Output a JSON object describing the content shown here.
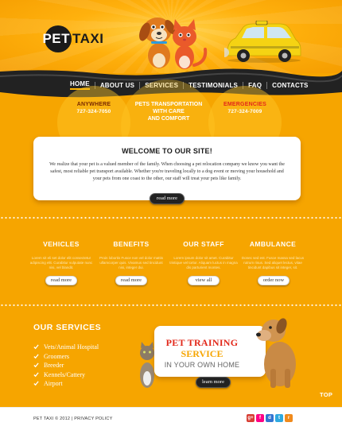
{
  "brand": {
    "logo_circle": "PET",
    "logo_rest": "TAXI"
  },
  "nav": {
    "items": [
      "HOME",
      "ABOUT US",
      "SERVICES",
      "TESTIMONIALS",
      "FAQ",
      "CONTACTS"
    ],
    "active": "HOME"
  },
  "contacts": {
    "anywhere": {
      "title": "ANYWHERE",
      "phone": "727-324-7050"
    },
    "tagline": [
      "PETS TRANSPORTATION",
      "WITH CARE",
      "AND COMFORT"
    ],
    "emergencies": {
      "title": "EMERGENCIES",
      "phone": "727-324-7009"
    }
  },
  "welcome": {
    "title": "WELCOME TO OUR SITE!",
    "text": "We realize that your pet is a valued member of the family. When choosing a pet relocation company we know you want the safest, most reliable pet transport available. Whether you're traveling locally to a dog event or moving your household and your pets from one coast to the other, our staff will treat your pets like family.",
    "button": "read more"
  },
  "features": [
    {
      "title": "VEHICLES",
      "text": "Lorem sit eli set dolor elit consectetur adipiscing elit. Curabitur vulputate nunc nisi, vel blandit.",
      "button": "read more"
    },
    {
      "title": "BENEFITS",
      "text": "Proin lobortis Fusce non vel dolor mattis ullamcorper quis. Vivamus sed tincidunt nisi, integer dui.",
      "button": "read more"
    },
    {
      "title": "OUR STAFF",
      "text": "Lorem ipsum dolor sit amet. Curabitur tristique vel tortor. Aliquam luctus in magna dis parturient montes.",
      "button": "view all"
    },
    {
      "title": "AMBULANCE",
      "text": "Donec sed est. Fusce massa sed lacus rutrum risus. Sed aliquet lectus, vitae tincidunt dapibus sit integer, sit.",
      "button": "order now"
    }
  ],
  "services": {
    "title": "OUR SERVICES",
    "items": [
      "Vets/Animal Hospital",
      "Groomers",
      "Breeder",
      "Kennels/Cattery",
      "Airport"
    ]
  },
  "promo": {
    "line1": "PET TRAINING",
    "line2": "SERVICE",
    "line3": "IN YOUR OWN HOME",
    "button": "learn more"
  },
  "top_link": "TOP",
  "footer": {
    "copyright": "PET TAXI © 2012",
    "separator": "|",
    "privacy": "PRIVACY POLICY"
  },
  "social": [
    {
      "name": "google-plus",
      "glyph": "g+",
      "color": "#d73d32"
    },
    {
      "name": "flickr",
      "glyph": "f",
      "color": "#ff0084"
    },
    {
      "name": "delicious",
      "glyph": "d",
      "color": "#3274d1"
    },
    {
      "name": "twitter",
      "glyph": "t",
      "color": "#2fa9e0"
    },
    {
      "name": "rss",
      "glyph": "r",
      "color": "#f08a1c"
    }
  ],
  "colors": {
    "accent": "#f6a500",
    "dark": "#1b1b1b",
    "red": "#e2281a"
  }
}
